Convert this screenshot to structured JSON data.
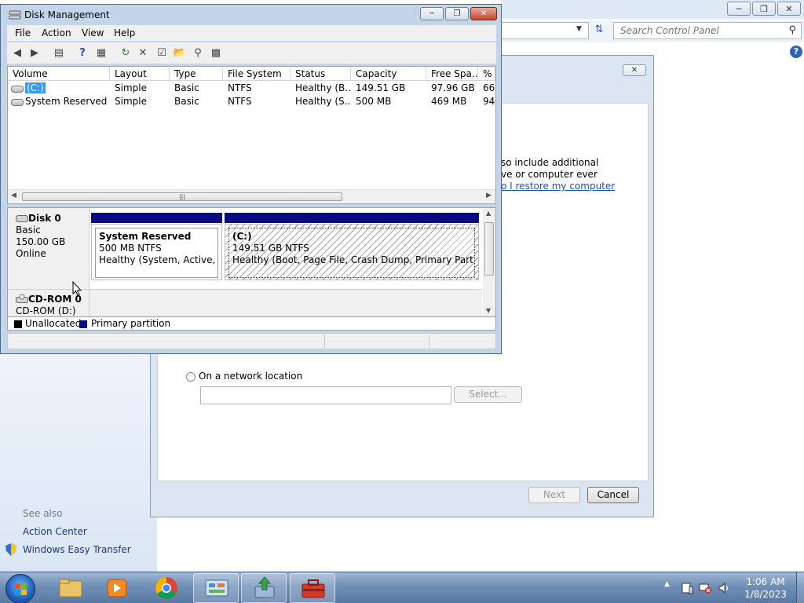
{
  "control_panel": {
    "search_placeholder": "Search Control Panel",
    "see_also": "See also",
    "links": [
      "Action Center",
      "Windows Easy Transfer"
    ]
  },
  "wizard": {
    "text_line1": "so include additional",
    "text_line2": "ve or computer ever",
    "link": "o I restore my computer",
    "network_radio": "On a network location",
    "select_button": "Select...",
    "next_button": "Next",
    "cancel_button": "Cancel"
  },
  "disk_management": {
    "title": "Disk Management",
    "menu": [
      "File",
      "Action",
      "View",
      "Help"
    ],
    "columns": [
      "Volume",
      "Layout",
      "Type",
      "File System",
      "Status",
      "Capacity",
      "Free Spa...",
      "% F"
    ],
    "rows": [
      [
        "(C:)",
        "Simple",
        "Basic",
        "NTFS",
        "Healthy (B...",
        "149.51 GB",
        "97.96 GB",
        "66"
      ],
      [
        "System Reserved",
        "Simple",
        "Basic",
        "NTFS",
        "Healthy (S...",
        "500 MB",
        "469 MB",
        "94"
      ]
    ],
    "disk0": {
      "name": "Disk 0",
      "type": "Basic",
      "size": "150.00 GB",
      "state": "Online"
    },
    "partitions": [
      {
        "name": "System Reserved",
        "size": "500 MB NTFS",
        "status": "Healthy (System, Active, Primary Partition)"
      },
      {
        "name": "(C:)",
        "size": "149.51 GB NTFS",
        "status": "Healthy (Boot, Page File, Crash Dump, Primary Partition)"
      }
    ],
    "cdrom": {
      "name": "CD-ROM 0",
      "drive": "CD-ROM (D:)"
    },
    "legend": [
      "Unallocated",
      "Primary partition"
    ],
    "colors": {
      "unallocated": "#000000",
      "primary": "#0a0a82"
    }
  },
  "taskbar": {
    "time": "1:06 AM",
    "date": "1/8/2023"
  }
}
